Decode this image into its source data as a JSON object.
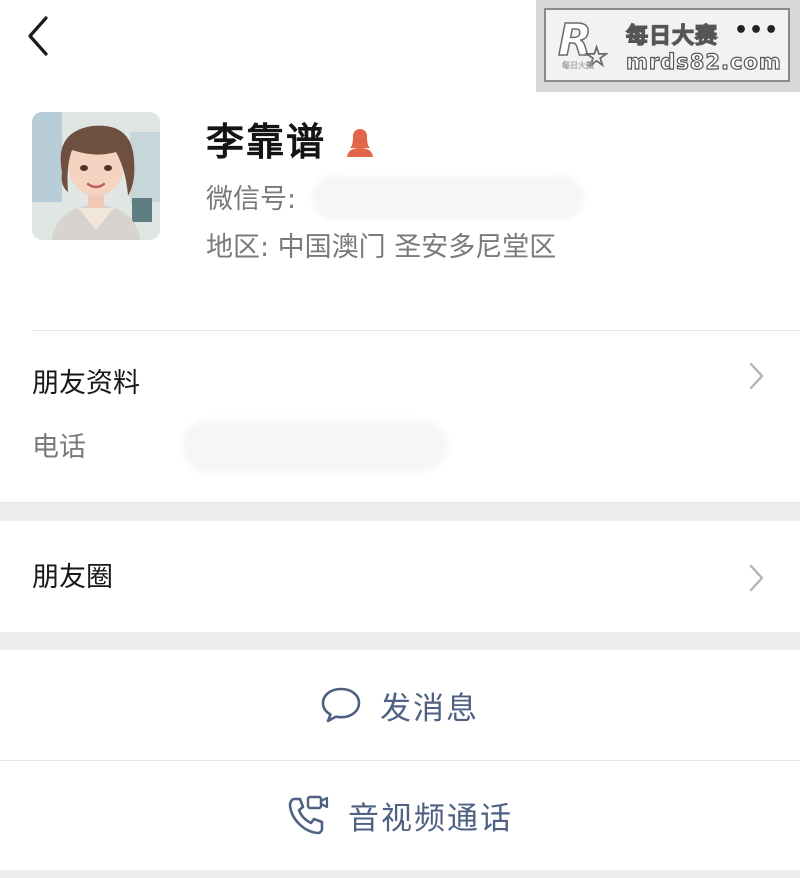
{
  "header": {
    "back_icon": "chevron-left-icon"
  },
  "watermark": {
    "logo_letter": "R",
    "logo_sub": "每日大赛",
    "title": "每日大赛",
    "more": "•••",
    "site": "mrds82.com"
  },
  "profile": {
    "name": "李靠谱",
    "gender_icon": "female-user-icon",
    "wechat_id_label": "微信号:",
    "region": "地区:  中国澳门  圣安多尼堂区"
  },
  "friend_info": {
    "title": "朋友资料",
    "phone_label": "电话"
  },
  "moments": {
    "title": "朋友圈"
  },
  "actions": {
    "message": "发消息",
    "call": "音视频通话"
  },
  "colors": {
    "accent": "#4f6183",
    "gender": "#e2674a",
    "band": "#ededed"
  }
}
